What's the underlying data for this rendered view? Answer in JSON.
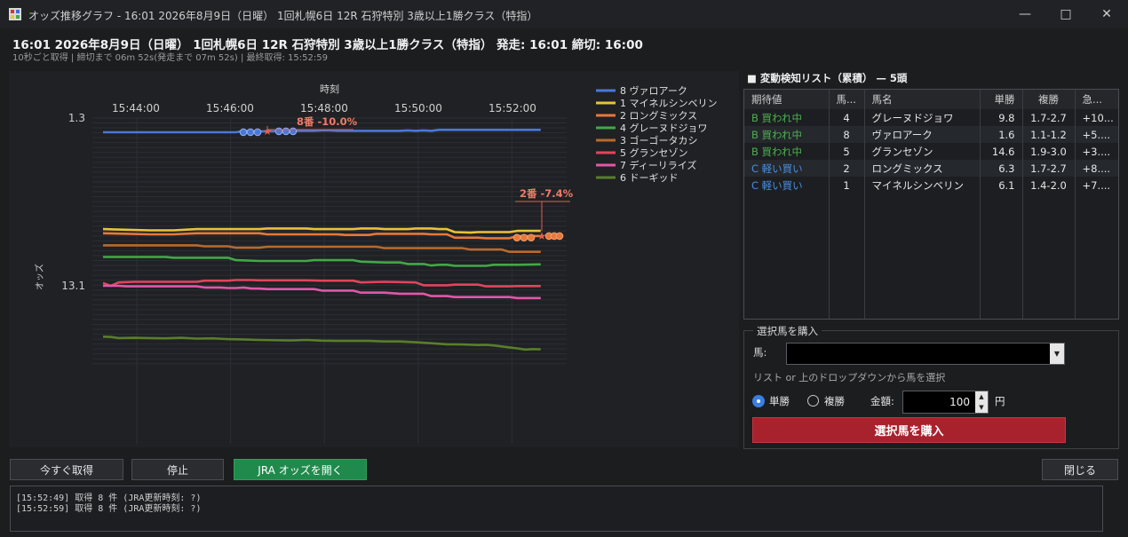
{
  "window": {
    "title": "オッズ推移グラフ - 16:01  2026年8月9日（日曜） 1回札幌6日  12R  石狩特別 3歳以上1勝クラス（特指）"
  },
  "header": {
    "main": "16:01  2026年8月9日（日曜）  1回札幌6日  12R  石狩特別 3歳以上1勝クラス（特指）   発走: 16:01   締切: 16:00",
    "sub": "10秒ごと取得   |   締切まで 06m 52s(発走まで 07m 52s)   |   最終取得: 15:52:59"
  },
  "chart_data": {
    "type": "line",
    "xlabel": "時刻",
    "ylabel": "オッズ",
    "x_ticks": [
      "15:44:00",
      "15:46:00",
      "15:48:00",
      "15:50:00",
      "15:52:00"
    ],
    "y_ticks": [
      "1.3",
      "13.1"
    ],
    "annotations": [
      {
        "text": "8番 -10.0%",
        "series": "8 ヴァロアーク"
      },
      {
        "text": "2番 -7.4%",
        "series": "2 ロングミックス"
      }
    ],
    "series": [
      {
        "name": "8 ヴァロアーク",
        "color": "#4a78d8",
        "pts": [
          [
            0,
            1.58
          ],
          [
            5,
            1.58
          ],
          [
            10,
            1.58
          ],
          [
            15,
            1.58
          ],
          [
            20,
            1.58
          ],
          [
            25,
            1.58
          ],
          [
            30,
            1.58
          ],
          [
            35,
            1.58
          ],
          [
            40,
            1.58
          ],
          [
            45,
            1.58
          ],
          [
            50,
            1.58
          ],
          [
            55,
            1.58
          ],
          [
            60,
            1.58
          ],
          [
            65,
            1.58
          ],
          [
            70,
            1.58
          ],
          [
            75,
            1.58
          ],
          [
            80,
            1.58
          ],
          [
            85,
            1.58
          ],
          [
            90,
            1.55
          ],
          [
            95,
            1.56
          ],
          [
            100,
            1.56
          ],
          [
            105,
            1.56
          ],
          [
            110,
            1.56
          ],
          [
            115,
            1.56
          ],
          [
            120,
            1.56
          ],
          [
            125,
            1.55
          ],
          [
            130,
            1.55
          ],
          [
            135,
            1.55
          ],
          [
            140,
            1.54
          ],
          [
            145,
            1.54
          ],
          [
            150,
            1.55
          ],
          [
            155,
            1.55
          ],
          [
            160,
            1.55
          ],
          [
            165,
            1.55
          ],
          [
            170,
            1.55
          ],
          [
            175,
            1.55
          ],
          [
            180,
            1.55
          ],
          [
            185,
            1.55
          ],
          [
            190,
            1.55
          ],
          [
            195,
            1.54
          ],
          [
            200,
            1.55
          ],
          [
            205,
            1.54
          ],
          [
            210,
            1.55
          ],
          [
            215,
            1.53
          ],
          [
            220,
            1.53
          ],
          [
            225,
            1.53
          ],
          [
            230,
            1.53
          ],
          [
            235,
            1.53
          ],
          [
            240,
            1.53
          ],
          [
            245,
            1.53
          ],
          [
            250,
            1.53
          ],
          [
            255,
            1.53
          ],
          [
            260,
            1.53
          ],
          [
            265,
            1.53
          ],
          [
            270,
            1.53
          ],
          [
            275,
            1.53
          ],
          [
            280,
            1.53
          ]
        ]
      },
      {
        "name": "1 マイネルシンベリン",
        "color": "#e8c33a",
        "pts": [
          [
            0,
            6.0
          ],
          [
            30,
            6.1
          ],
          [
            45,
            6.1
          ],
          [
            60,
            6.0
          ],
          [
            100,
            6.0
          ],
          [
            105,
            5.95
          ],
          [
            130,
            5.95
          ],
          [
            135,
            6.0
          ],
          [
            160,
            6.0
          ],
          [
            165,
            5.95
          ],
          [
            175,
            5.95
          ],
          [
            180,
            6.0
          ],
          [
            195,
            6.0
          ],
          [
            200,
            5.95
          ],
          [
            210,
            5.95
          ],
          [
            215,
            6.0
          ],
          [
            220,
            6.0
          ],
          [
            225,
            6.25
          ],
          [
            235,
            6.3
          ],
          [
            240,
            6.25
          ],
          [
            260,
            6.25
          ],
          [
            265,
            6.15
          ],
          [
            280,
            6.15
          ]
        ]
      },
      {
        "name": "2 ロングミックス",
        "color": "#e8783a",
        "pts": [
          [
            0,
            6.35
          ],
          [
            30,
            6.45
          ],
          [
            45,
            6.45
          ],
          [
            60,
            6.35
          ],
          [
            100,
            6.35
          ],
          [
            105,
            6.45
          ],
          [
            150,
            6.45
          ],
          [
            155,
            6.5
          ],
          [
            170,
            6.5
          ],
          [
            175,
            6.4
          ],
          [
            205,
            6.4
          ],
          [
            210,
            6.45
          ],
          [
            220,
            6.45
          ],
          [
            225,
            6.75
          ],
          [
            240,
            6.75
          ],
          [
            245,
            6.8
          ],
          [
            260,
            6.8
          ],
          [
            265,
            6.6
          ],
          [
            280,
            6.6
          ]
        ]
      },
      {
        "name": "4 グレーヌドジョワ",
        "color": "#43a848",
        "pts": [
          [
            0,
            8.8
          ],
          [
            40,
            8.8
          ],
          [
            45,
            8.9
          ],
          [
            80,
            8.9
          ],
          [
            85,
            9.2
          ],
          [
            100,
            9.3
          ],
          [
            130,
            9.3
          ],
          [
            135,
            9.2
          ],
          [
            160,
            9.2
          ],
          [
            165,
            9.4
          ],
          [
            180,
            9.5
          ],
          [
            190,
            9.5
          ],
          [
            195,
            9.7
          ],
          [
            205,
            9.7
          ],
          [
            210,
            9.9
          ],
          [
            215,
            9.8
          ],
          [
            220,
            9.8
          ],
          [
            225,
            9.95
          ],
          [
            245,
            9.95
          ],
          [
            250,
            9.8
          ],
          [
            260,
            9.8
          ],
          [
            265,
            9.8
          ],
          [
            280,
            9.75
          ]
        ]
      },
      {
        "name": "3 ゴーゴータカシ",
        "color": "#b86a2e",
        "pts": [
          [
            0,
            7.5
          ],
          [
            60,
            7.5
          ],
          [
            65,
            7.6
          ],
          [
            80,
            7.6
          ],
          [
            85,
            7.75
          ],
          [
            100,
            7.75
          ],
          [
            105,
            7.65
          ],
          [
            175,
            7.65
          ],
          [
            180,
            7.8
          ],
          [
            230,
            7.8
          ],
          [
            235,
            7.95
          ],
          [
            255,
            7.95
          ],
          [
            260,
            8.2
          ],
          [
            275,
            8.2
          ],
          [
            280,
            8.2
          ]
        ]
      },
      {
        "name": "5 グランセゾン",
        "color": "#e0455e",
        "pts": [
          [
            0,
            12.6
          ],
          [
            5,
            13.1
          ],
          [
            10,
            12.5
          ],
          [
            20,
            12.4
          ],
          [
            60,
            12.4
          ],
          [
            65,
            12.2
          ],
          [
            70,
            12.2
          ],
          [
            80,
            12.2
          ],
          [
            85,
            12.1
          ],
          [
            95,
            12.1
          ],
          [
            100,
            12.15
          ],
          [
            130,
            12.15
          ],
          [
            140,
            12.2
          ],
          [
            160,
            12.2
          ],
          [
            165,
            12.5
          ],
          [
            180,
            12.4
          ],
          [
            200,
            12.5
          ],
          [
            205,
            13.0
          ],
          [
            220,
            13.0
          ],
          [
            225,
            12.9
          ],
          [
            240,
            12.9
          ],
          [
            245,
            13.2
          ],
          [
            260,
            13.2
          ],
          [
            265,
            13.15
          ],
          [
            280,
            13.15
          ]
        ]
      },
      {
        "name": "7 ディーリライズ",
        "color": "#e058a8",
        "pts": [
          [
            0,
            13.1
          ],
          [
            10,
            13.1
          ],
          [
            15,
            13.2
          ],
          [
            60,
            13.2
          ],
          [
            65,
            13.4
          ],
          [
            75,
            13.4
          ],
          [
            80,
            13.5
          ],
          [
            85,
            13.5
          ],
          [
            90,
            13.4
          ],
          [
            95,
            13.6
          ],
          [
            100,
            13.6
          ],
          [
            105,
            13.7
          ],
          [
            135,
            13.7
          ],
          [
            140,
            14.0
          ],
          [
            160,
            14.0
          ],
          [
            165,
            14.4
          ],
          [
            180,
            14.4
          ],
          [
            190,
            14.6
          ],
          [
            205,
            14.6
          ],
          [
            210,
            15.1
          ],
          [
            220,
            15.1
          ],
          [
            225,
            15.3
          ],
          [
            260,
            15.3
          ],
          [
            265,
            15.5
          ],
          [
            280,
            15.5
          ]
        ]
      },
      {
        "name": "6 ドーギッド",
        "color": "#5a7e2a",
        "pts": [
          [
            0,
            26.4
          ],
          [
            5,
            26.5
          ],
          [
            10,
            26.9
          ],
          [
            20,
            26.8
          ],
          [
            30,
            26.9
          ],
          [
            40,
            27.0
          ],
          [
            50,
            26.8
          ],
          [
            60,
            27.1
          ],
          [
            70,
            27.0
          ],
          [
            80,
            27.3
          ],
          [
            90,
            27.4
          ],
          [
            100,
            27.6
          ],
          [
            120,
            27.8
          ],
          [
            130,
            27.6
          ],
          [
            140,
            27.9
          ],
          [
            150,
            28.0
          ],
          [
            160,
            28.0
          ],
          [
            170,
            28.0
          ],
          [
            180,
            28.2
          ],
          [
            190,
            28.2
          ],
          [
            200,
            28.5
          ],
          [
            210,
            28.9
          ],
          [
            220,
            29.3
          ],
          [
            230,
            29.4
          ],
          [
            240,
            29.6
          ],
          [
            245,
            29.5
          ],
          [
            250,
            29.8
          ],
          [
            255,
            30.2
          ],
          [
            260,
            30.6
          ],
          [
            265,
            31.0
          ],
          [
            270,
            31.5
          ],
          [
            275,
            31.3
          ],
          [
            280,
            31.4
          ]
        ]
      }
    ]
  },
  "right_panel": {
    "title": "■ 変動検知リスト（累積） — 5頭",
    "columns": [
      "期待値",
      "馬...",
      "馬名",
      "単勝",
      "複勝",
      "急..."
    ],
    "rows": [
      {
        "expect": "B 買われ中",
        "num": "4",
        "name": "グレーヌドジョワ",
        "win": "9.8",
        "place": "1.7-2.7",
        "rapid": "+10...",
        "color": "#4caf50"
      },
      {
        "expect": "B 買われ中",
        "num": "8",
        "name": "ヴァロアーク",
        "win": "1.6",
        "place": "1.1-1.2",
        "rapid": "+5....",
        "color": "#4caf50"
      },
      {
        "expect": "B 買われ中",
        "num": "5",
        "name": "グランセゾン",
        "win": "14.6",
        "place": "1.9-3.0",
        "rapid": "+3....",
        "color": "#4caf50"
      },
      {
        "expect": "C 軽い買い",
        "num": "2",
        "name": "ロングミックス",
        "win": "6.3",
        "place": "1.7-2.7",
        "rapid": "+8....",
        "color": "#4a8fe0"
      },
      {
        "expect": "C 軽い買い",
        "num": "1",
        "name": "マイネルシンベリン",
        "win": "6.1",
        "place": "1.4-2.0",
        "rapid": "+7....",
        "color": "#4a8fe0"
      }
    ]
  },
  "buy": {
    "legend": "選択馬を購入",
    "horse_label": "馬:",
    "horse_value": "",
    "hint": "リスト or 上のドロップダウンから馬を選択",
    "opt_win": "単勝",
    "opt_place": "複勝",
    "amount_label": "金額:",
    "amount": "100",
    "yen": "円",
    "buy_button": "選択馬を購入"
  },
  "controls": {
    "fetch": "今すぐ取得",
    "stop": "停止",
    "open_jra": "JRA オッズを開く",
    "close": "閉じる"
  },
  "log": [
    "[15:52:49] 取得 8 件 (JRA更新時刻: ?)",
    "[15:52:59] 取得 8 件 (JRA更新時刻: ?)"
  ]
}
